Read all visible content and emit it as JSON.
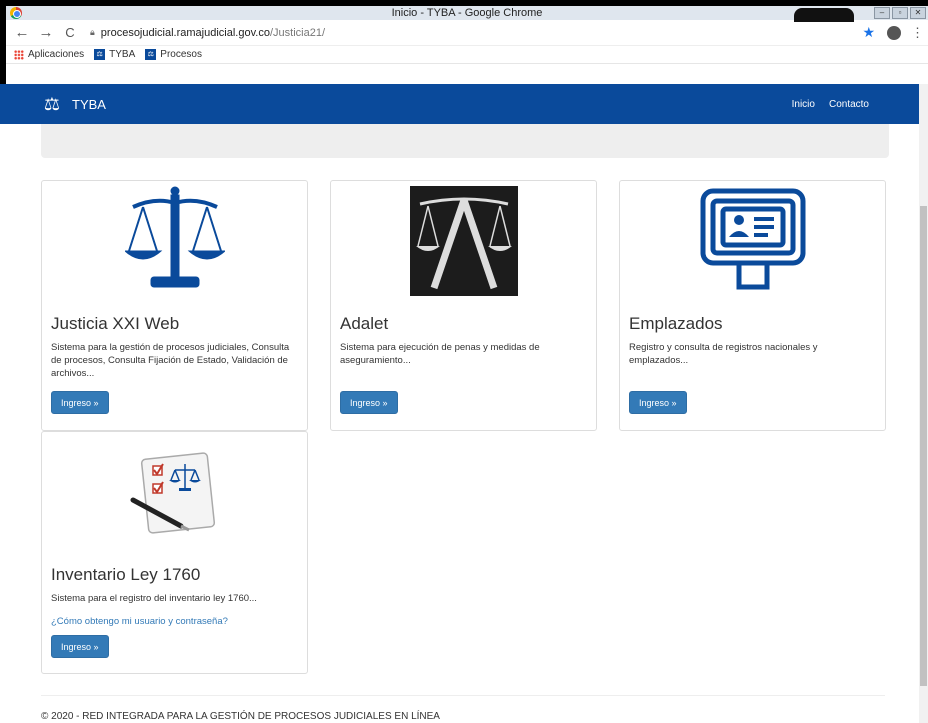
{
  "window": {
    "title": "Inicio - TYBA - Google Chrome"
  },
  "toolbar": {
    "url_host": "procesojudicial.ramajudicial.gov.co",
    "url_path": "/Justicia21/"
  },
  "bookmarks": {
    "items": [
      {
        "label": "Aplicaciones",
        "icon": "apps-grid-icon"
      },
      {
        "label": "TYBA",
        "icon": "tyba-favicon"
      },
      {
        "label": "Procesos",
        "icon": "tyba-favicon"
      }
    ]
  },
  "navbar": {
    "brand": "TYBA",
    "links": [
      "Inicio",
      "Contacto"
    ]
  },
  "cards": [
    {
      "title": "Justicia XXI Web",
      "desc": "Sistema para la gestión de procesos judiciales, Consulta de procesos, Consulta Fijación de Estado, Validación de archivos...",
      "button": "Ingreso »"
    },
    {
      "title": "Adalet",
      "desc": "Sistema para ejecución de penas y medidas de aseguramiento...",
      "button": "Ingreso »"
    },
    {
      "title": "Emplazados",
      "desc": "Registro y consulta de registros nacionales y emplazados...",
      "button": "Ingreso »"
    },
    {
      "title": "Inventario Ley 1760",
      "desc": "Sistema para el registro del inventario ley 1760...",
      "link": "¿Cómo obtengo mi usuario y contraseña?",
      "button": "Ingreso »"
    }
  ],
  "footer": {
    "text": "© 2020 - RED INTEGRADA PARA LA GESTIÓN DE PROCESOS JUDICIALES EN LÍNEA"
  },
  "colors": {
    "brand_blue": "#0a4a9b",
    "button_blue": "#337ab7"
  }
}
